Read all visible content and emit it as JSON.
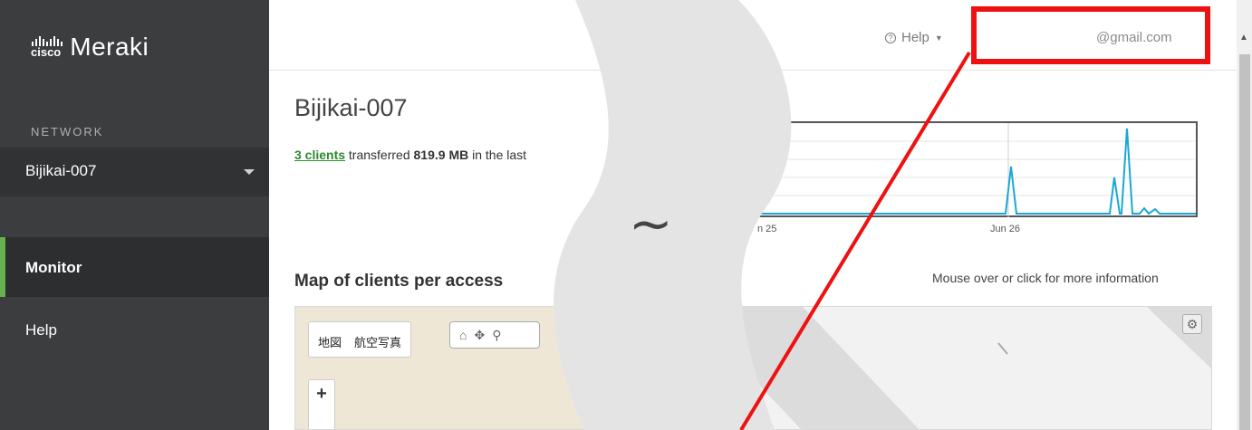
{
  "sidebar": {
    "logo_cisco": "cisco",
    "logo_brand": "Meraki",
    "section_label": "NETWORK",
    "network_selected": "Bijikai-007",
    "nav": [
      {
        "label": "Monitor",
        "active": true
      },
      {
        "label": "Help",
        "active": false
      }
    ]
  },
  "header": {
    "help_label": "Help",
    "account": "@gmail.com"
  },
  "main": {
    "title": "Bijikai-007",
    "summary_link": "3 clients",
    "summary_mid": "transferred",
    "summary_amount": "819.9 MB",
    "summary_tail": "in the last",
    "chart_ticks": [
      "n 25",
      "Jun 26"
    ],
    "map_title": "Map of clients per access",
    "map_hint": "Mouse over or click for more information",
    "map_type_map": "地図",
    "map_type_aerial": "航空写真",
    "zoom_in": "+",
    "tilde": "~"
  },
  "colors": {
    "sidebar_bg": "#3b3d3f",
    "active_accent": "#67b04f",
    "link_green": "#2c8a2c",
    "chart_line": "#1aa7d6",
    "highlight_red": "#ee1111"
  },
  "chart_data": {
    "type": "line",
    "x": [
      "n 25",
      "Jun 26"
    ],
    "series": [
      {
        "values": [
          0,
          0,
          0,
          0,
          0.58,
          0,
          0,
          0.95,
          0.05,
          0.02,
          0
        ]
      }
    ],
    "ylim": [
      0,
      1
    ],
    "grid": true
  }
}
